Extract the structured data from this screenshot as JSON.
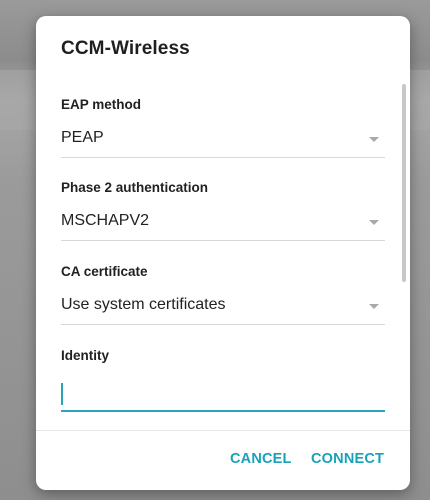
{
  "dialog": {
    "title": "CCM-Wireless"
  },
  "form": {
    "eap_method": {
      "label": "EAP method",
      "value": "PEAP"
    },
    "phase2": {
      "label": "Phase 2 authentication",
      "value": "MSCHAPV2"
    },
    "ca_certificate": {
      "label": "CA certificate",
      "value": "Use system certificates"
    },
    "identity": {
      "label": "Identity",
      "value": ""
    }
  },
  "buttons": {
    "cancel": "CANCEL",
    "connect": "CONNECT"
  },
  "colors": {
    "accent": "#17a2b8",
    "text": "#212121",
    "divider": "#d8d8d8"
  },
  "icons": {
    "dropdown": "dropdown-caret-icon"
  }
}
